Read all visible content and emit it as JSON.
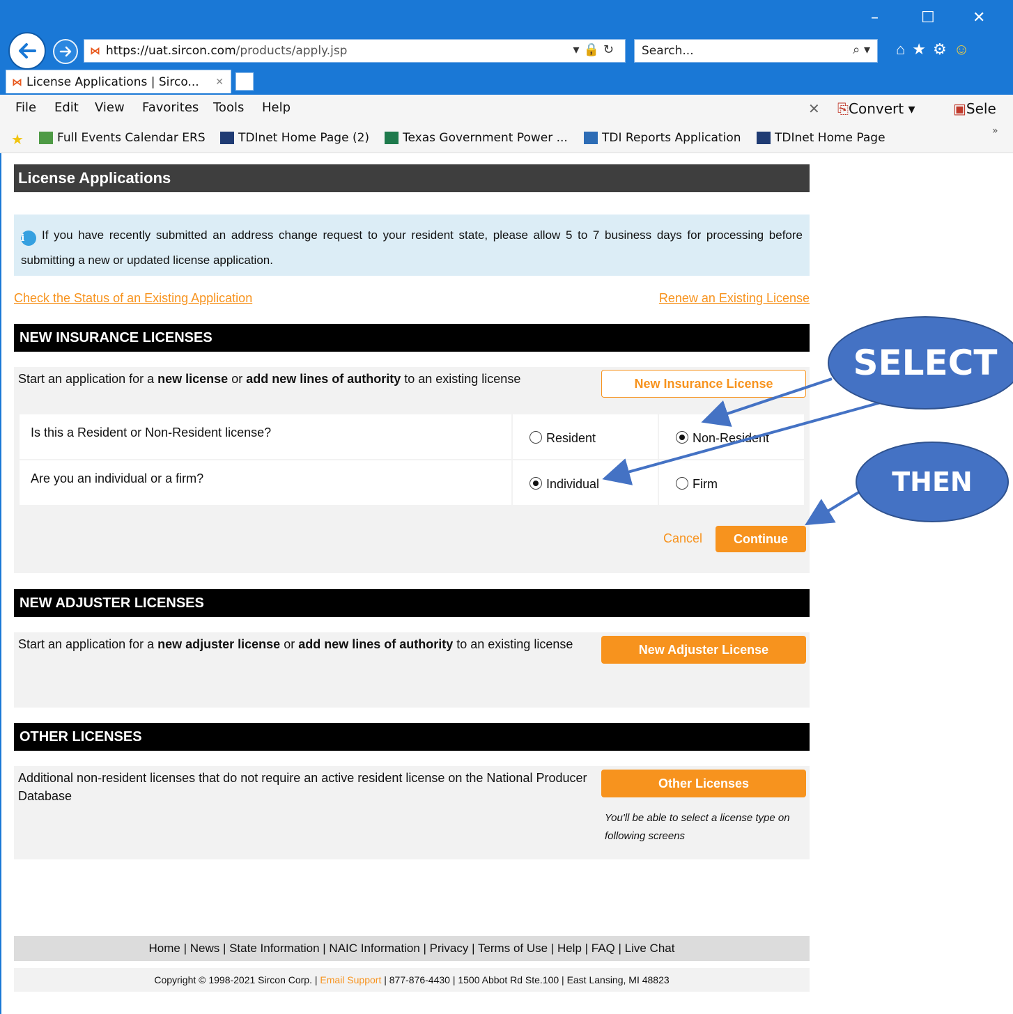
{
  "browser": {
    "url_prefix": "https://",
    "url_host": "uat.sircon.com",
    "url_path": "/products/apply.jsp",
    "search_placeholder": "Search...",
    "tab_title": "License Applications | Sirco...",
    "menu": [
      "File",
      "Edit",
      "View",
      "Favorites",
      "Tools",
      "Help"
    ],
    "convert_label": "Convert",
    "select_label": "Sele",
    "favorites": [
      "Full Events Calendar  ERS",
      "TDInet Home Page (2)",
      "Texas Government Power ...",
      "TDI Reports Application",
      "TDInet Home Page"
    ]
  },
  "page": {
    "title": "License Applications",
    "info_text": "If you have recently submitted an address change request to your resident state, please allow 5 to 7 business days for processing before submitting a new or updated license application.",
    "link_check_status": "Check the Status of an Existing Application",
    "link_renew": "Renew an Existing License"
  },
  "insurance": {
    "heading": "NEW INSURANCE LICENSES",
    "text_pre": "Start an application for a ",
    "text_b1": "new license",
    "text_mid": " or ",
    "text_b2": "add new lines of authority",
    "text_post": " to an existing license",
    "button": "New Insurance License",
    "q1": "Is this a Resident or Non-Resident license?",
    "q1_opt1": "Resident",
    "q1_opt2": "Non-Resident",
    "q2": "Are you an individual or a firm?",
    "q2_opt1": "Individual",
    "q2_opt2": "Firm",
    "cancel": "Cancel",
    "continue": "Continue"
  },
  "adjuster": {
    "heading": "NEW ADJUSTER LICENSES",
    "text_pre": "Start an application for a ",
    "text_b1": "new adjuster license",
    "text_mid": " or ",
    "text_b2": "add new lines of authority",
    "text_post": " to an existing license",
    "button": "New Adjuster License"
  },
  "other": {
    "heading": "OTHER LICENSES",
    "text": "Additional non-resident licenses that do not require an active resident license on the National Producer Database",
    "button": "Other Licenses",
    "note": "You'll be able to select a license type on following screens"
  },
  "footer": {
    "links": "Home | News | State Information | NAIC Information | Privacy | Terms of Use | Help | FAQ | Live Chat",
    "copy_pre": "Copyright © 1998-2021 Sircon Corp. | ",
    "email": "Email Support",
    "copy_post": " | 877-876-4430 | 1500 Abbot Rd Ste.100 | East Lansing, MI 48823"
  },
  "annotations": {
    "select": "SELECT",
    "then": "THEN"
  },
  "colors": {
    "accent_orange": "#f7931e",
    "chrome_blue": "#1a78d6",
    "callout_blue": "#4472c4"
  }
}
